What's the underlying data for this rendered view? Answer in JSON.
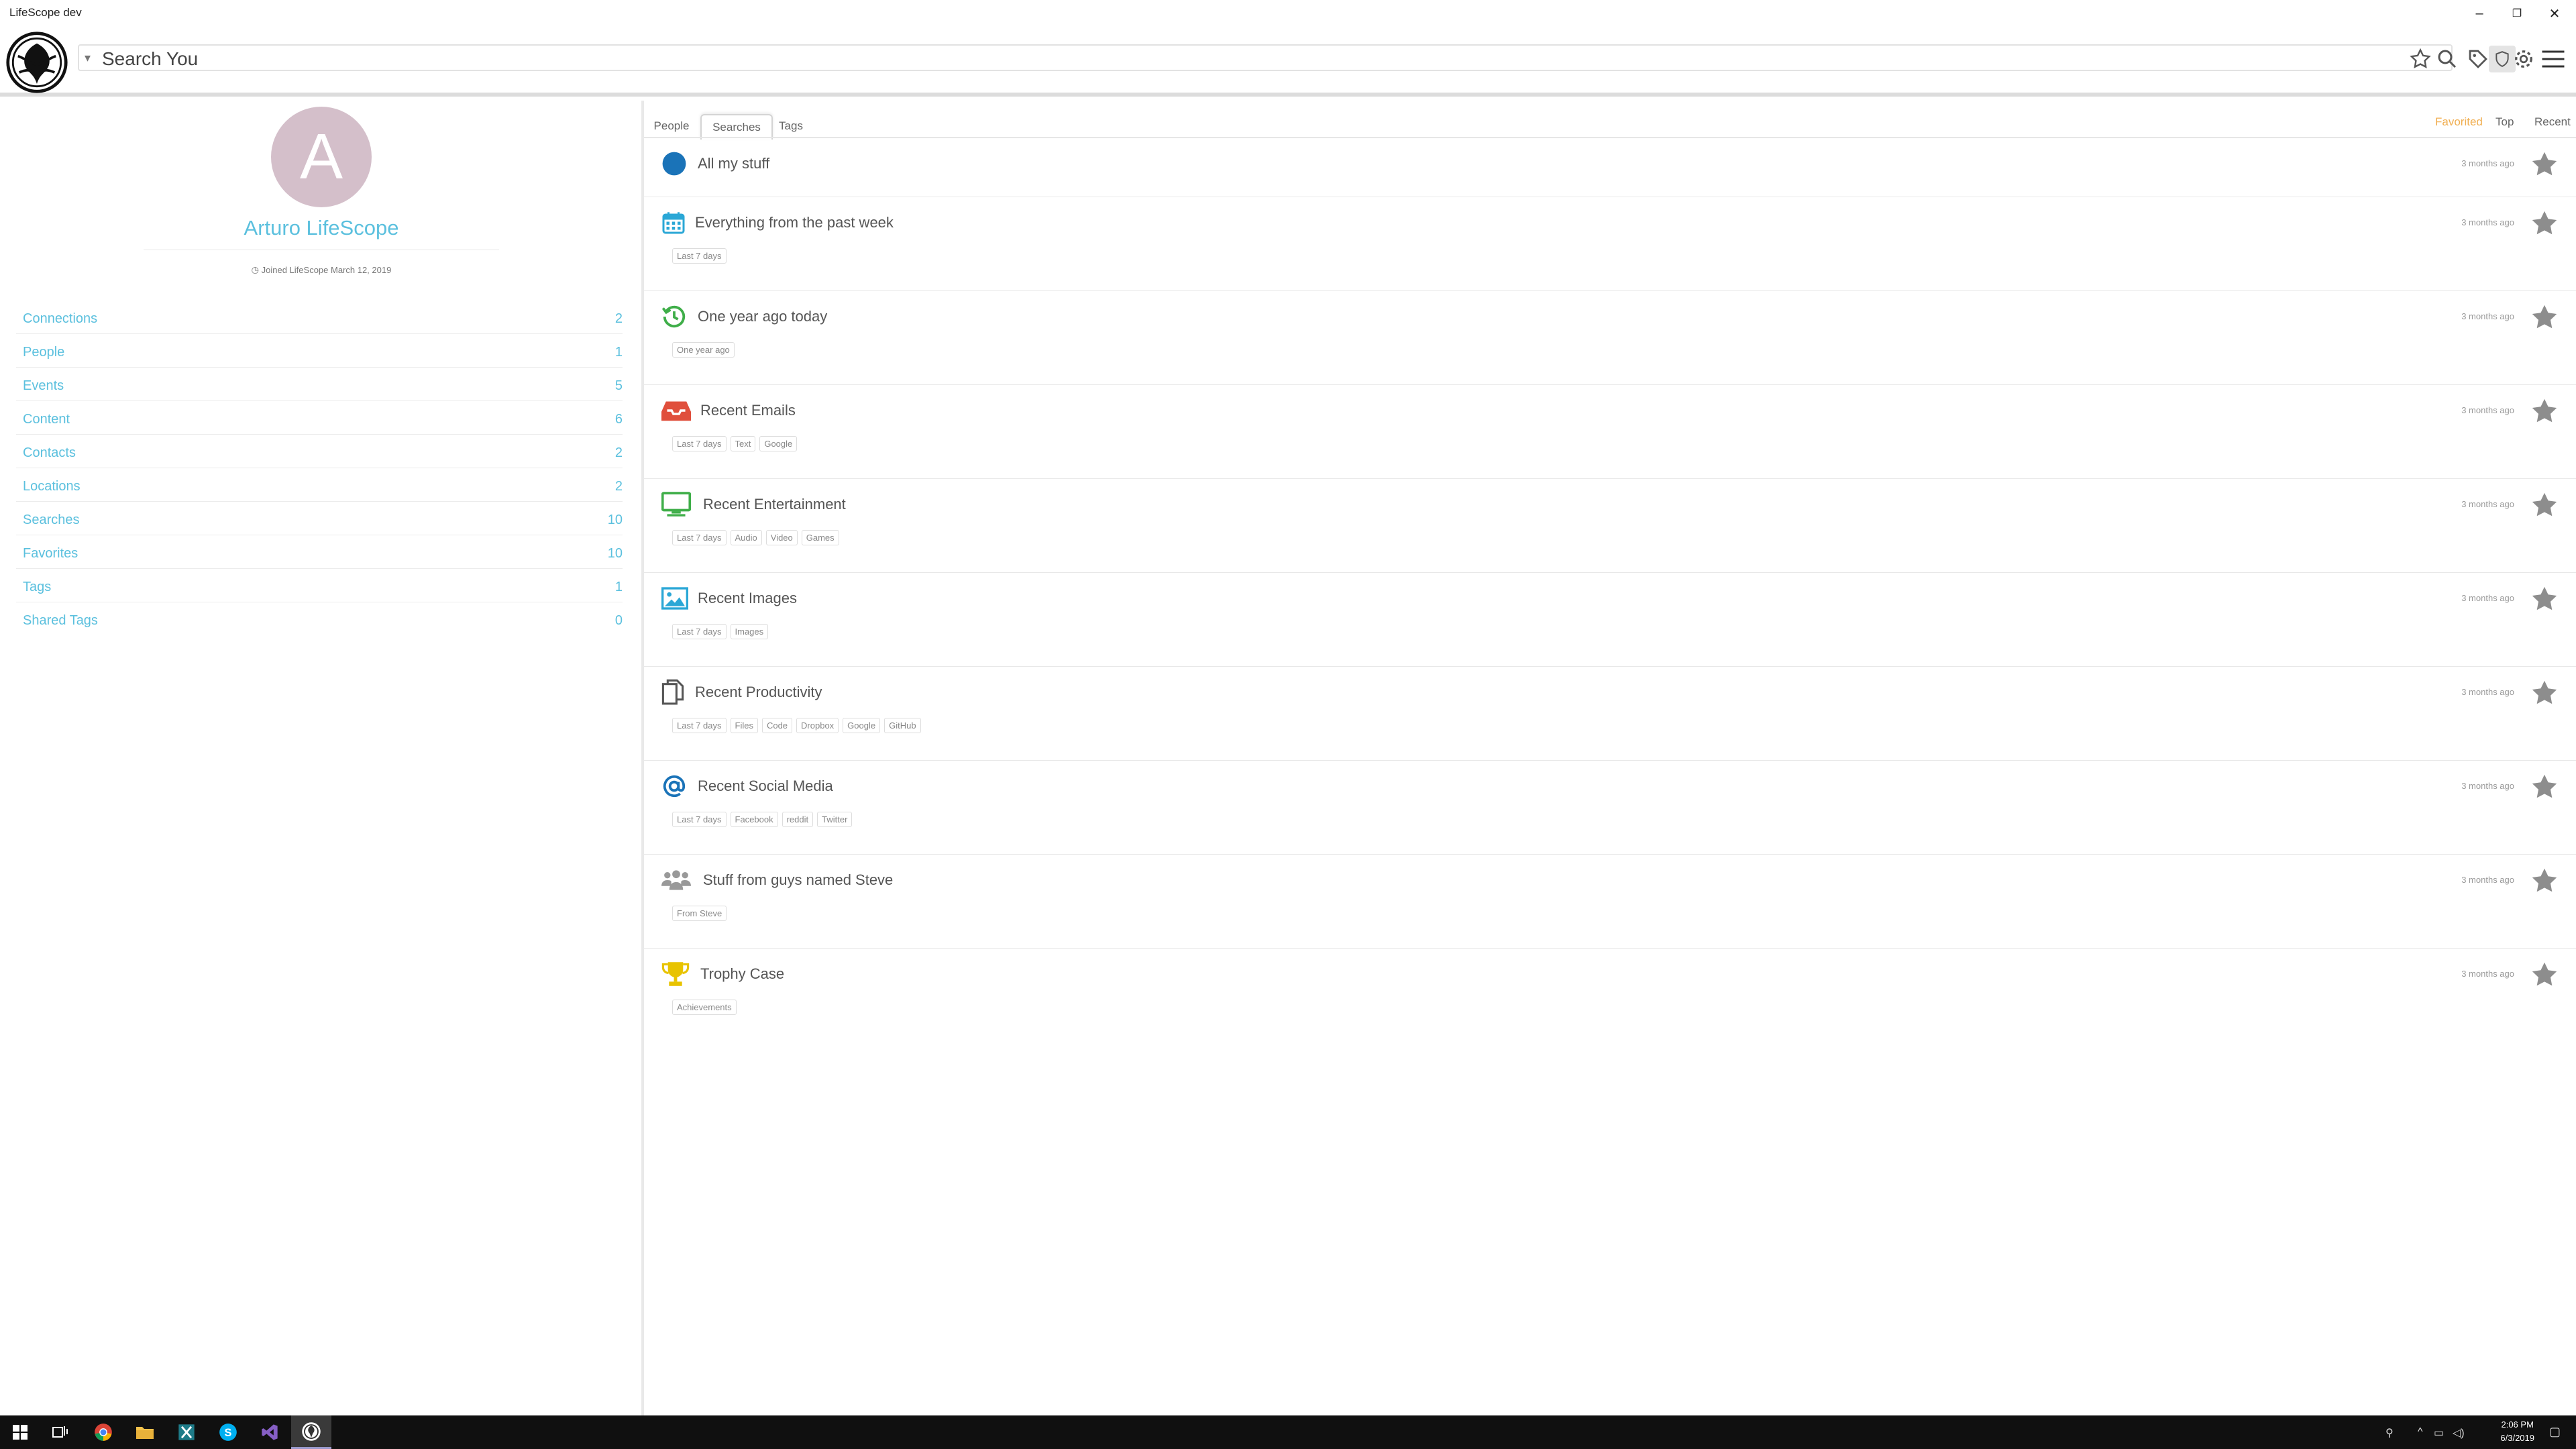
{
  "window": {
    "title": "LifeScope dev",
    "minimize": "–",
    "restore": "❐",
    "close": "✕"
  },
  "header": {
    "search_text": "Search You",
    "icons": [
      "star-outline-icon",
      "search-icon",
      "tag-icon",
      "shield-icon",
      "gear-icon",
      "menu-icon"
    ]
  },
  "profile": {
    "avatar_letter": "A",
    "name": "Arturo LifeScope",
    "joined": "Joined LifeScope March 12, 2019",
    "stats": [
      {
        "label": "Connections",
        "count": "2"
      },
      {
        "label": "People",
        "count": "1"
      },
      {
        "label": "Events",
        "count": "5"
      },
      {
        "label": "Content",
        "count": "6"
      },
      {
        "label": "Contacts",
        "count": "2"
      },
      {
        "label": "Locations",
        "count": "2"
      },
      {
        "label": "Searches",
        "count": "10"
      },
      {
        "label": "Favorites",
        "count": "10"
      },
      {
        "label": "Tags",
        "count": "1"
      },
      {
        "label": "Shared Tags",
        "count": "0"
      }
    ]
  },
  "tabs": {
    "people": "People",
    "searches": "Searches",
    "tags": "Tags",
    "active": "Searches"
  },
  "sort": {
    "favorited": "Favorited",
    "top": "Top",
    "recent": "Recent",
    "active": "Favorited",
    "active_color": "#f0ad4e"
  },
  "searches": [
    {
      "name": "All my stuff",
      "time": "3 months ago",
      "icon": "globe-icon",
      "color": "#1a73b8",
      "tags": []
    },
    {
      "name": "Everything from the past week",
      "time": "3 months ago",
      "icon": "calendar-icon",
      "color": "#2aa7d6",
      "tags": [
        "Last 7 days"
      ]
    },
    {
      "name": "One year ago today",
      "time": "3 months ago",
      "icon": "history-icon",
      "color": "#3fae49",
      "tags": [
        "One year ago"
      ]
    },
    {
      "name": "Recent Emails",
      "time": "3 months ago",
      "icon": "inbox-icon",
      "color": "#e04f3c",
      "tags": [
        "Last 7 days",
        "Text",
        "Google"
      ]
    },
    {
      "name": "Recent Entertainment",
      "time": "3 months ago",
      "icon": "monitor-icon",
      "color": "#3fae49",
      "tags": [
        "Last 7 days",
        "Audio",
        "Video",
        "Games"
      ]
    },
    {
      "name": "Recent Images",
      "time": "3 months ago",
      "icon": "image-icon",
      "color": "#2aa7d6",
      "tags": [
        "Last 7 days",
        "Images"
      ]
    },
    {
      "name": "Recent Productivity",
      "time": "3 months ago",
      "icon": "copy-icon",
      "color": "#555555",
      "tags": [
        "Last 7 days",
        "Files",
        "Code",
        "Dropbox",
        "Google",
        "GitHub"
      ]
    },
    {
      "name": "Recent Social Media",
      "time": "3 months ago",
      "icon": "at-icon",
      "color": "#1a73b8",
      "tags": [
        "Last 7 days",
        "Facebook",
        "reddit",
        "Twitter"
      ]
    },
    {
      "name": "Stuff from guys named Steve",
      "time": "3 months ago",
      "icon": "users-icon",
      "color": "#999999",
      "tags": [
        "From Steve"
      ]
    },
    {
      "name": "Trophy Case",
      "time": "3 months ago",
      "icon": "trophy-icon",
      "color": "#e8c300",
      "tags": [
        "Achievements"
      ]
    }
  ],
  "taskbar": {
    "apps": [
      "windows-start-icon",
      "task-view-icon",
      "chrome-icon",
      "file-explorer-icon",
      "xamarin-icon",
      "skype-icon",
      "visual-studio-icon",
      "lifescope-icon"
    ],
    "time": "2:06 PM",
    "date": "6/3/2019"
  }
}
